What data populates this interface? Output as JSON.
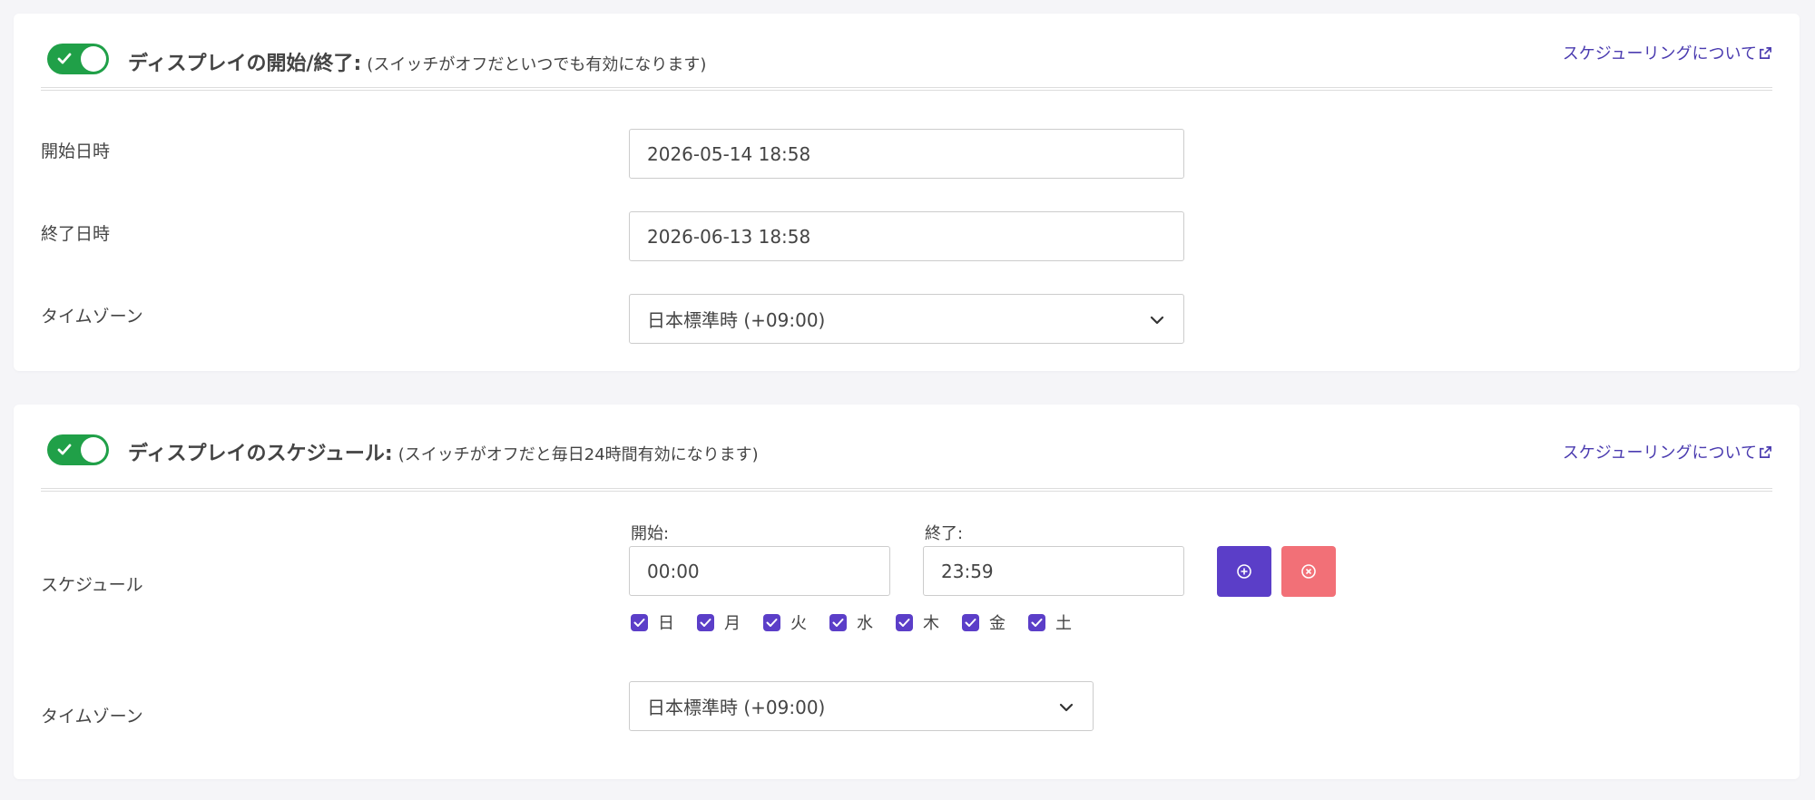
{
  "display_period": {
    "toggle_on": true,
    "title": "ディスプレイの開始/終了:",
    "note": "(スイッチがオフだといつでも有効になります)",
    "help_link": "スケジューリングについて",
    "start_label": "開始日時",
    "start_value": "2026-05-14 18:58",
    "end_label": "終了日時",
    "end_value": "2026-06-13 18:58",
    "timezone_label": "タイムゾーン",
    "timezone_value": "日本標準時 (+09:00)"
  },
  "display_schedule": {
    "toggle_on": true,
    "title": "ディスプレイのスケジュール:",
    "note": "(スイッチがオフだと毎日24時間有効になります)",
    "help_link": "スケジューリングについて",
    "schedule_label": "スケジュール",
    "start_label": "開始:",
    "start_value": "00:00",
    "end_label": "終了:",
    "end_value": "23:59",
    "days": [
      {
        "label": "日",
        "checked": true
      },
      {
        "label": "月",
        "checked": true
      },
      {
        "label": "火",
        "checked": true
      },
      {
        "label": "水",
        "checked": true
      },
      {
        "label": "木",
        "checked": true
      },
      {
        "label": "金",
        "checked": true
      },
      {
        "label": "土",
        "checked": true
      }
    ],
    "timezone_label": "タイムゾーン",
    "timezone_value": "日本標準時 (+09:00)",
    "add_icon": "plus-circle-icon",
    "remove_icon": "x-circle-icon"
  },
  "colors": {
    "toggle_on": "#20a048",
    "link": "#4b3cb0",
    "primary": "#5b3ec8",
    "danger": "#f27077"
  }
}
